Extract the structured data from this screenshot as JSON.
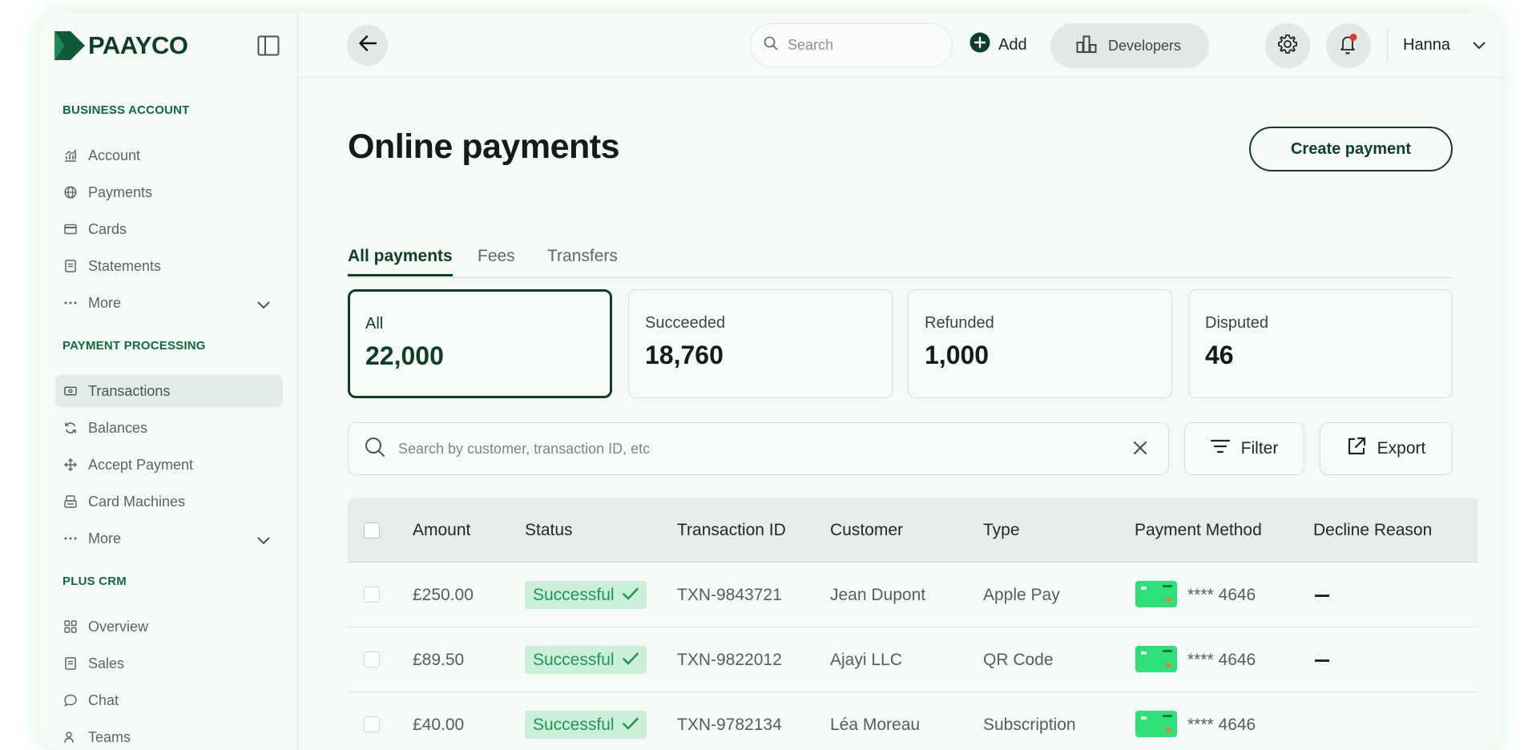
{
  "brand": {
    "name": "PAAYCO",
    "accent": "#0e3d2a",
    "logo_color": "#0f5a38"
  },
  "sidebar": {
    "sections": [
      {
        "title": "BUSINESS ACCOUNT",
        "items": [
          {
            "label": "Account",
            "icon": "bar-chart-icon"
          },
          {
            "label": "Payments",
            "icon": "globe-icon"
          },
          {
            "label": "Cards",
            "icon": "credit-card-icon"
          },
          {
            "label": "Statements",
            "icon": "document-icon"
          },
          {
            "label": "More",
            "icon": "ellipsis-icon"
          }
        ]
      },
      {
        "title": "PAYMENT PROCESSING",
        "items": [
          {
            "label": "Transactions",
            "icon": "banknote-icon",
            "active": true
          },
          {
            "label": "Balances",
            "icon": "refresh-icon"
          },
          {
            "label": "Accept Payment",
            "icon": "move-icon"
          },
          {
            "label": "Card Machines",
            "icon": "card-machine-icon"
          },
          {
            "label": "More",
            "icon": "ellipsis-icon"
          }
        ]
      },
      {
        "title": "PLUS CRM",
        "items": [
          {
            "label": "Overview",
            "icon": "grid-icon"
          },
          {
            "label": "Sales",
            "icon": "document-icon"
          },
          {
            "label": "Chat",
            "icon": "chat-bubble-icon"
          },
          {
            "label": "Teams",
            "icon": "users-icon"
          }
        ]
      }
    ]
  },
  "header": {
    "search_placeholder": "Search",
    "add_label": "Add",
    "developers_label": "Developers",
    "user_name": "Hanna",
    "notification_dot_color": "#e53935"
  },
  "main": {
    "title": "Online payments",
    "create_button": "Create payment",
    "tabs": [
      {
        "label": "All payments",
        "active": true
      },
      {
        "label": "Fees"
      },
      {
        "label": "Transfers"
      }
    ],
    "stats": [
      {
        "label": "All",
        "value": "22,000",
        "active": true
      },
      {
        "label": "Succeeded",
        "value": "18,760"
      },
      {
        "label": "Refunded",
        "value": "1,000"
      },
      {
        "label": "Disputed",
        "value": "46"
      }
    ],
    "search_placeholder": "Search by customer, transaction ID, etc",
    "filter_label": "Filter",
    "export_label": "Export"
  },
  "table": {
    "columns": [
      "Amount",
      "Status",
      "Transaction ID",
      "Customer",
      "Type",
      "Payment Method",
      "Decline Reason"
    ],
    "rows": [
      {
        "amount": "£250.00",
        "status": "Successful",
        "transaction_id": "TXN-9843721",
        "customer": "Jean Dupont",
        "type": "Apple Pay",
        "card": "**** 4646"
      },
      {
        "amount": "£89.50",
        "status": "Successful",
        "transaction_id": "TXN-9822012",
        "customer": "Ajayi LLC",
        "type": "QR Code",
        "card": "**** 4646"
      },
      {
        "amount": "£40.00",
        "status": "Successful",
        "transaction_id": "TXN-9782134",
        "customer": "Léa Moreau",
        "type": "Subscription",
        "card": "**** 4646"
      }
    ]
  },
  "colors": {
    "success_bg": "#ccefd9",
    "success_text": "#1b9950",
    "card_green": "#2fe07a",
    "background": "#f5faf6"
  }
}
